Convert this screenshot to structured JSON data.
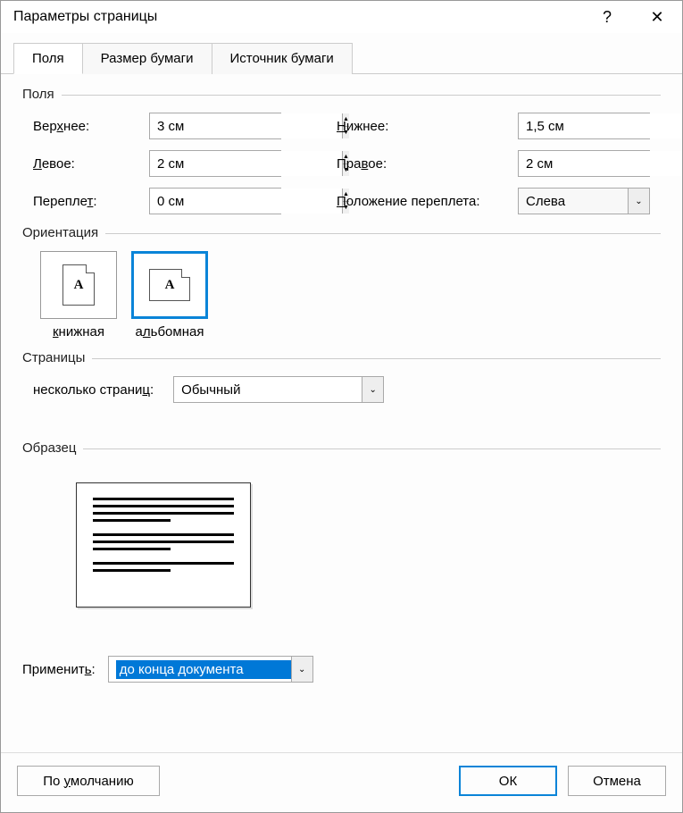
{
  "title": "Параметры страницы",
  "help": "?",
  "close": "✕",
  "tabs": {
    "fields": "Поля",
    "paperSize": "Размер бумаги",
    "paperSource": "Источник бумаги"
  },
  "groupFields": "Поля",
  "margins": {
    "topLabel": "Верхнее:",
    "topHotkey": "х",
    "topValue": "3 см",
    "bottomLabel": "Нижнее:",
    "bottomHotkey": "Н",
    "bottomValue": "1,5 см",
    "leftLabel": "Левое:",
    "leftHotkey": "Л",
    "leftValue": "2 см",
    "rightLabel": "Правое:",
    "rightHotkey": "в",
    "rightValue": "2 см",
    "gutterLabel": "Переплет:",
    "gutterHotkey": "т",
    "gutterValue": "0 см",
    "gutterPosLabel": "Положение переплета:",
    "gutterPosHotkey": "П",
    "gutterPosValue": "Слева"
  },
  "orientation": {
    "title": "Ориентация",
    "portrait": "книжная",
    "portraitHotkey": "к",
    "landscape": "альбомная",
    "landscapeHotkey": "л",
    "glyph": "A"
  },
  "pages": {
    "title": "Страницы",
    "multiLabel": "несколько страниц:",
    "multiHotkey": "ц",
    "multiValue": "Обычный"
  },
  "preview": {
    "title": "Образец"
  },
  "apply": {
    "label": "Применить:",
    "hotkey": "ь",
    "value": "до конца документа"
  },
  "buttons": {
    "default": "По умолчанию",
    "defaultHotkey": "у",
    "ok": "ОК",
    "cancel": "Отмена"
  }
}
